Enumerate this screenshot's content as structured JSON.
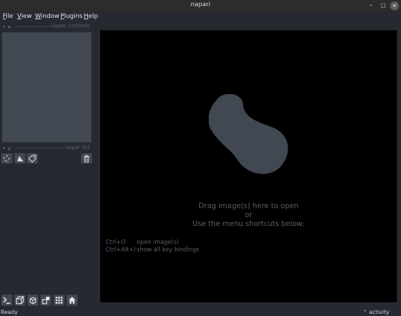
{
  "window": {
    "title": "napari",
    "minimize": "‒",
    "maximize": "□",
    "close": "✕"
  },
  "menubar": {
    "items": [
      {
        "first": "F",
        "rest": "ile"
      },
      {
        "first": "V",
        "rest": "iew"
      },
      {
        "first": "W",
        "rest": "indow"
      },
      {
        "first": "P",
        "rest": "lugins"
      },
      {
        "first": "H",
        "rest": "elp"
      }
    ]
  },
  "dock": {
    "layer_controls_title": "layer controls",
    "layer_list_title": "layer list",
    "handle_dots": "• ▫"
  },
  "layer_buttons": {
    "new_points": "new-points-icon",
    "new_shapes": "new-shapes-icon",
    "new_labels": "new-labels-icon",
    "delete": "delete-layer-icon"
  },
  "viewer_buttons": [
    "console-icon",
    "ndisplay-icon",
    "roll-icon",
    "transpose-icon",
    "grid-icon",
    "home-icon"
  ],
  "welcome": {
    "line1": "Drag image(s) here to open",
    "line2": "or",
    "line3": "Use the menu shortcuts below:",
    "shortcuts": [
      {
        "key": "Ctrl+O",
        "desc": "open image(s)"
      },
      {
        "key": "Ctrl+Alt+/",
        "desc": "show all key bindings"
      }
    ]
  },
  "status": {
    "ready": "Ready",
    "activity": "⌃ activity"
  },
  "colors": {
    "background": "#262930",
    "panel": "#414851",
    "canvas": "#000000",
    "logo": "#414851"
  }
}
